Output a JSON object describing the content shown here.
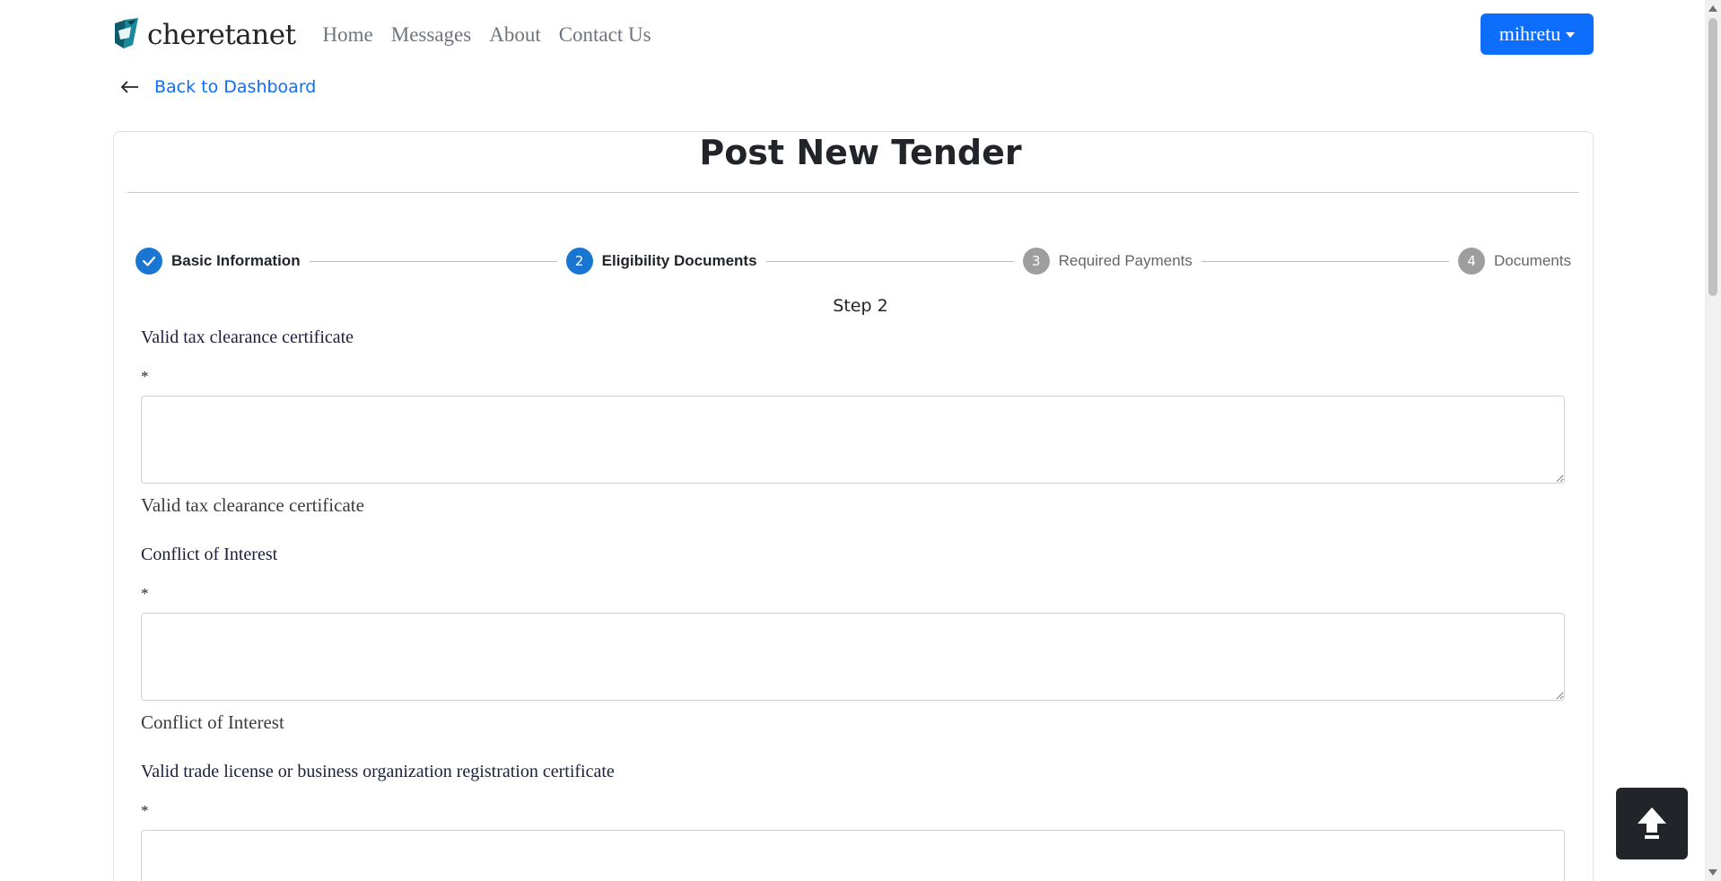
{
  "navbar": {
    "brand": "cheretanet",
    "links": [
      "Home",
      "Messages",
      "About",
      "Contact Us"
    ],
    "user_menu": "mihretu"
  },
  "back_link": "Back to Dashboard",
  "card": {
    "title": "Post New Tender",
    "steps": [
      {
        "number": "",
        "label": "Basic Information",
        "state": "completed"
      },
      {
        "number": "2",
        "label": "Eligibility Documents",
        "state": "active"
      },
      {
        "number": "3",
        "label": "Required Payments",
        "state": "inactive"
      },
      {
        "number": "4",
        "label": "Documents",
        "state": "inactive"
      }
    ],
    "step_caption": "Step 2"
  },
  "fields": [
    {
      "label": "Valid tax clearance certificate",
      "required": "*",
      "value": "",
      "helper": "Valid tax clearance certificate"
    },
    {
      "label": "Conflict of Interest",
      "required": "*",
      "value": "",
      "helper": "Conflict of Interest"
    },
    {
      "label": "Valid trade license or business organization registration certificate",
      "required": "*",
      "value": "",
      "helper": ""
    }
  ],
  "colors": {
    "primary": "#0d6efd",
    "step_active": "#1976d2",
    "step_inactive": "#9e9e9e",
    "dark": "#212529"
  },
  "icons": {
    "brand": "cheretanet-logo",
    "back": "arrow-left-icon",
    "completed_step": "check-icon",
    "scroll_top": "arrow-up-icon"
  }
}
